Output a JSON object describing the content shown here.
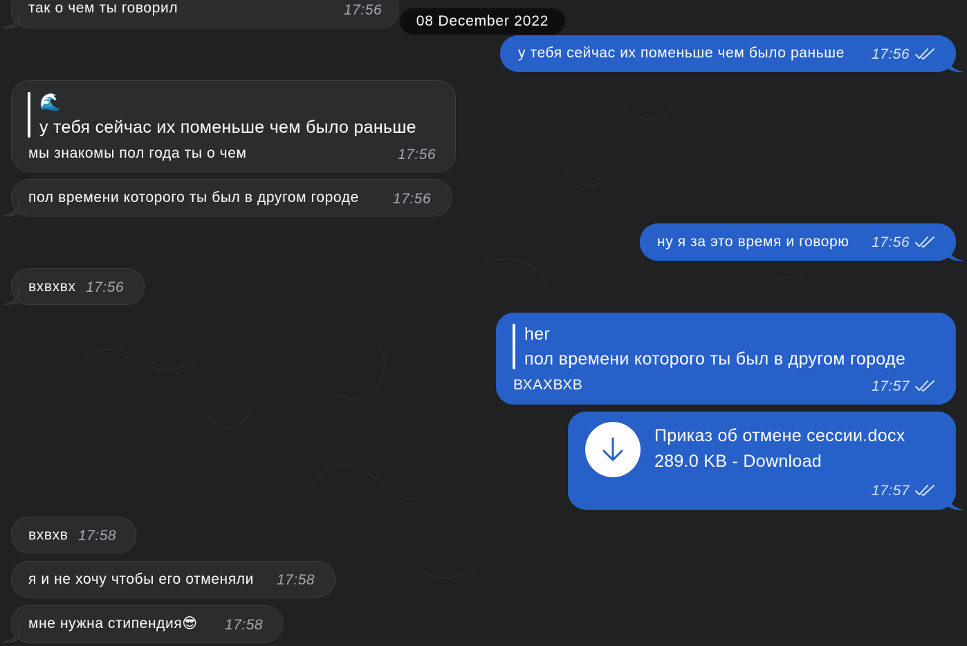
{
  "date_separator": "08 December 2022",
  "messages": [
    {
      "text": "так о чем ты говорил",
      "time": "17:56"
    },
    {
      "text": "у тебя сейчас их поменьше чем было раньше",
      "time": "17:56"
    },
    {
      "reply_sender": "🌊",
      "reply_text": "у тебя сейчас их поменьше чем было раньше",
      "text": "мы знакомы пол года ты о чем",
      "time": "17:56"
    },
    {
      "text": "пол времени которого ты был в другом городе",
      "time": "17:56"
    },
    {
      "text": "ну я за это время и говорю",
      "time": "17:56"
    },
    {
      "text": "вхвхвх",
      "time": "17:56"
    },
    {
      "reply_sender": "her",
      "reply_text": "пол времени которого ты был в другом городе",
      "text": "ВХАХВХВ",
      "time": "17:57"
    },
    {
      "file_name": "Приказ об отмене сессии.docx",
      "file_size": "289.0 KB",
      "separator": "-",
      "download_label": "Download",
      "time": "17:57"
    },
    {
      "text": "вхвхв",
      "time": "17:58"
    },
    {
      "text": "я и не хочу чтобы его отменяли",
      "time": "17:58"
    },
    {
      "text": "мне нужна стипендия😎",
      "time": "17:58"
    }
  ],
  "icons": {
    "read_receipt": "double-check-icon",
    "download": "arrow-down-icon"
  },
  "colors": {
    "background": "#1f2122",
    "incoming_bubble": "#2a2c2e",
    "outgoing_bubble": "#2760c8",
    "date_pill": "#0d0e0f",
    "download_arrow": "#2760c8"
  }
}
